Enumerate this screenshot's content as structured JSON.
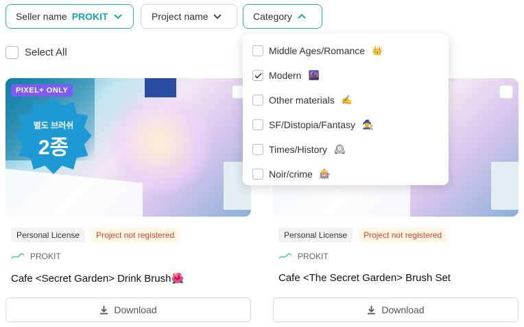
{
  "filters": {
    "seller_label": "Seller name",
    "seller_value": "PROKIT",
    "project_label": "Project name",
    "category_label": "Category"
  },
  "select_all_label": "Select All",
  "category_dropdown": {
    "options": [
      {
        "label": "Middle Ages/Romance",
        "emoji": "👑",
        "checked": false
      },
      {
        "label": "Modern",
        "emoji": "🌆",
        "checked": true
      },
      {
        "label": "Other materials",
        "emoji": "✍",
        "checked": false
      },
      {
        "label": "SF/Distopia/Fantasy",
        "emoji": "🧙",
        "checked": false
      },
      {
        "label": "Times/History",
        "emoji": "🕰",
        "checked": false
      },
      {
        "label": "Noir/crime",
        "emoji": "🎰",
        "checked": false
      }
    ]
  },
  "cards": [
    {
      "badge": "PIXEL+ ONLY",
      "brush_badge_line1": "별도 브러쉬",
      "brush_badge_line2": "2종",
      "license": "Personal License",
      "status": "Project not registered",
      "seller": "PROKIT",
      "title": "Cafe <Secret Garden> Drink Brush🌺",
      "download": "Download"
    },
    {
      "license": "Personal License",
      "status": "Project not registered",
      "seller": "PROKIT",
      "title": "Cafe <The Secret Garden> Brush Set",
      "download": "Download"
    }
  ],
  "colors": {
    "accent": "#17a5ae",
    "status_text": "#d1451f",
    "pixel_badge": "#7d5cf0"
  }
}
